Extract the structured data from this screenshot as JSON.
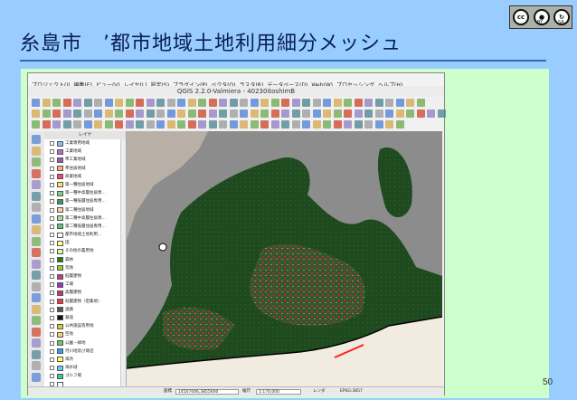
{
  "slide": {
    "title": "糸島市　’都市地域土地利用細分メッシュ",
    "page_number": "50"
  },
  "license": {
    "badge_main": "cc",
    "badge_by": "BY",
    "badge_sa": "SA"
  },
  "qgis": {
    "window_title": "QGIS 2.2.0-Valmiera - 40230itoshimB",
    "menus": [
      "プロジェクト(J)",
      "編集(E)",
      "ビュー(V)",
      "レイヤ(L)",
      "設定(S)",
      "プラグイン(P)",
      "ベクタ(O)",
      "ラスタ(R)",
      "データベース(D)",
      "Web(W)",
      "プロセッシング",
      "ヘルプ(H)"
    ],
    "layer_panel_title": "レイヤ",
    "layer_items": [
      {
        "label": "工業専用地域",
        "color": "#7ec0ee"
      },
      {
        "label": "工業地域",
        "color": "#b070d0"
      },
      {
        "label": "準工業地域",
        "color": "#9b59b6"
      },
      {
        "label": "準住居地域",
        "color": "#ffb070"
      },
      {
        "label": "商業地域",
        "color": "#ff4060"
      },
      {
        "label": "第一種住居地域",
        "color": "#ffe070"
      },
      {
        "label": "第一種中高層住居専…",
        "color": "#80d080"
      },
      {
        "label": "第一種低層住居専用…",
        "color": "#30a060"
      },
      {
        "label": "第二種住居地域",
        "color": "#ffd0a0"
      },
      {
        "label": "第二種中高層住居専…",
        "color": "#a0e0a0"
      },
      {
        "label": "第二種低層住居専用…",
        "color": "#60c080"
      },
      {
        "label": "都市地域土地利用…",
        "color": "#ffffff"
      },
      {
        "label": "田",
        "color": "#ffff99"
      },
      {
        "label": "その他の農用地",
        "color": "#ccff99"
      },
      {
        "label": "森林",
        "color": "#1e7b1e"
      },
      {
        "label": "荒地",
        "color": "#99cc33"
      },
      {
        "label": "低層建物",
        "color": "#cc3399"
      },
      {
        "label": "工場",
        "color": "#9933cc"
      },
      {
        "label": "高層建物",
        "color": "#cc3366"
      },
      {
        "label": "低層建物（密集地）",
        "color": "#ff3333"
      },
      {
        "label": "道路",
        "color": "#555555"
      },
      {
        "label": "鉄道",
        "color": "#111111"
      },
      {
        "label": "公共施設等用地",
        "color": "#cccc33"
      },
      {
        "label": "空地",
        "color": "#ffcc66"
      },
      {
        "label": "公園・緑地",
        "color": "#66cc66"
      },
      {
        "label": "河川地及び湖沼",
        "color": "#3399ff"
      },
      {
        "label": "海浜",
        "color": "#ffff66"
      },
      {
        "label": "海水域",
        "color": "#66ccff"
      },
      {
        "label": "ゴルフ場",
        "color": "#33cc99"
      },
      {
        "label": "",
        "color": "#ffffff"
      },
      {
        "label": "その他用途地域",
        "color": "#dddddd"
      },
      {
        "label": "",
        "color": "#ffffff"
      },
      {
        "label": "市街化調整区域",
        "color": "#888888"
      }
    ],
    "status": {
      "coord_label": "座標",
      "coord_value": "14507046,3855600",
      "scale_label": "縮尺",
      "scale_value": "1:170,000",
      "render_label": "レンダ",
      "crs_label": "EPSG:3857"
    }
  }
}
